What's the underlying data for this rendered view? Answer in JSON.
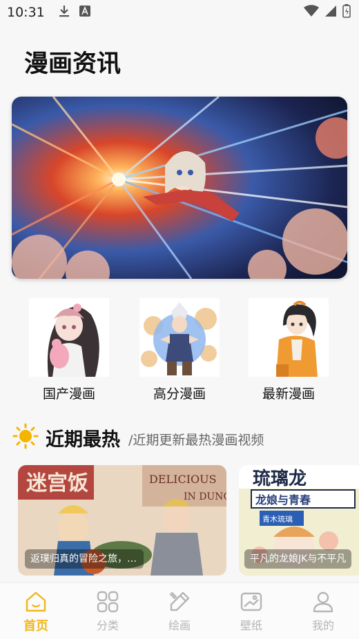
{
  "status_bar": {
    "time": "10:31"
  },
  "page_title": "漫画资讯",
  "hero": {
    "image": "anime-girl-flying-through-starburst-banner"
  },
  "categories": [
    {
      "label": "国产漫画",
      "image": "girl-with-pink-plush-bunny"
    },
    {
      "label": "高分漫画",
      "image": "warrior-in-energy-burst"
    },
    {
      "label": "最新漫画",
      "image": "girl-with-orange-backpack"
    }
  ],
  "section": {
    "title": "近期最热",
    "subtitle": "/近期更新最热漫画视频",
    "icon": "sun-icon"
  },
  "videos": [
    {
      "caption": "返璞归真的冒险之旅，简...",
      "image": "dungeon-meshi-cover"
    },
    {
      "caption": "平凡的龙娘JK与不平凡",
      "image": "dragon-girl-manga-cover"
    }
  ],
  "nav": [
    {
      "label": "首页",
      "icon": "home-icon",
      "active": true
    },
    {
      "label": "分类",
      "icon": "grid-icon",
      "active": false
    },
    {
      "label": "绘画",
      "icon": "brush-icon",
      "active": false
    },
    {
      "label": "壁纸",
      "icon": "wallpaper-icon",
      "active": false
    },
    {
      "label": "我的",
      "icon": "profile-icon",
      "active": false
    }
  ],
  "colors": {
    "accent": "#f2b61b",
    "inactive": "#b5b5b5"
  }
}
